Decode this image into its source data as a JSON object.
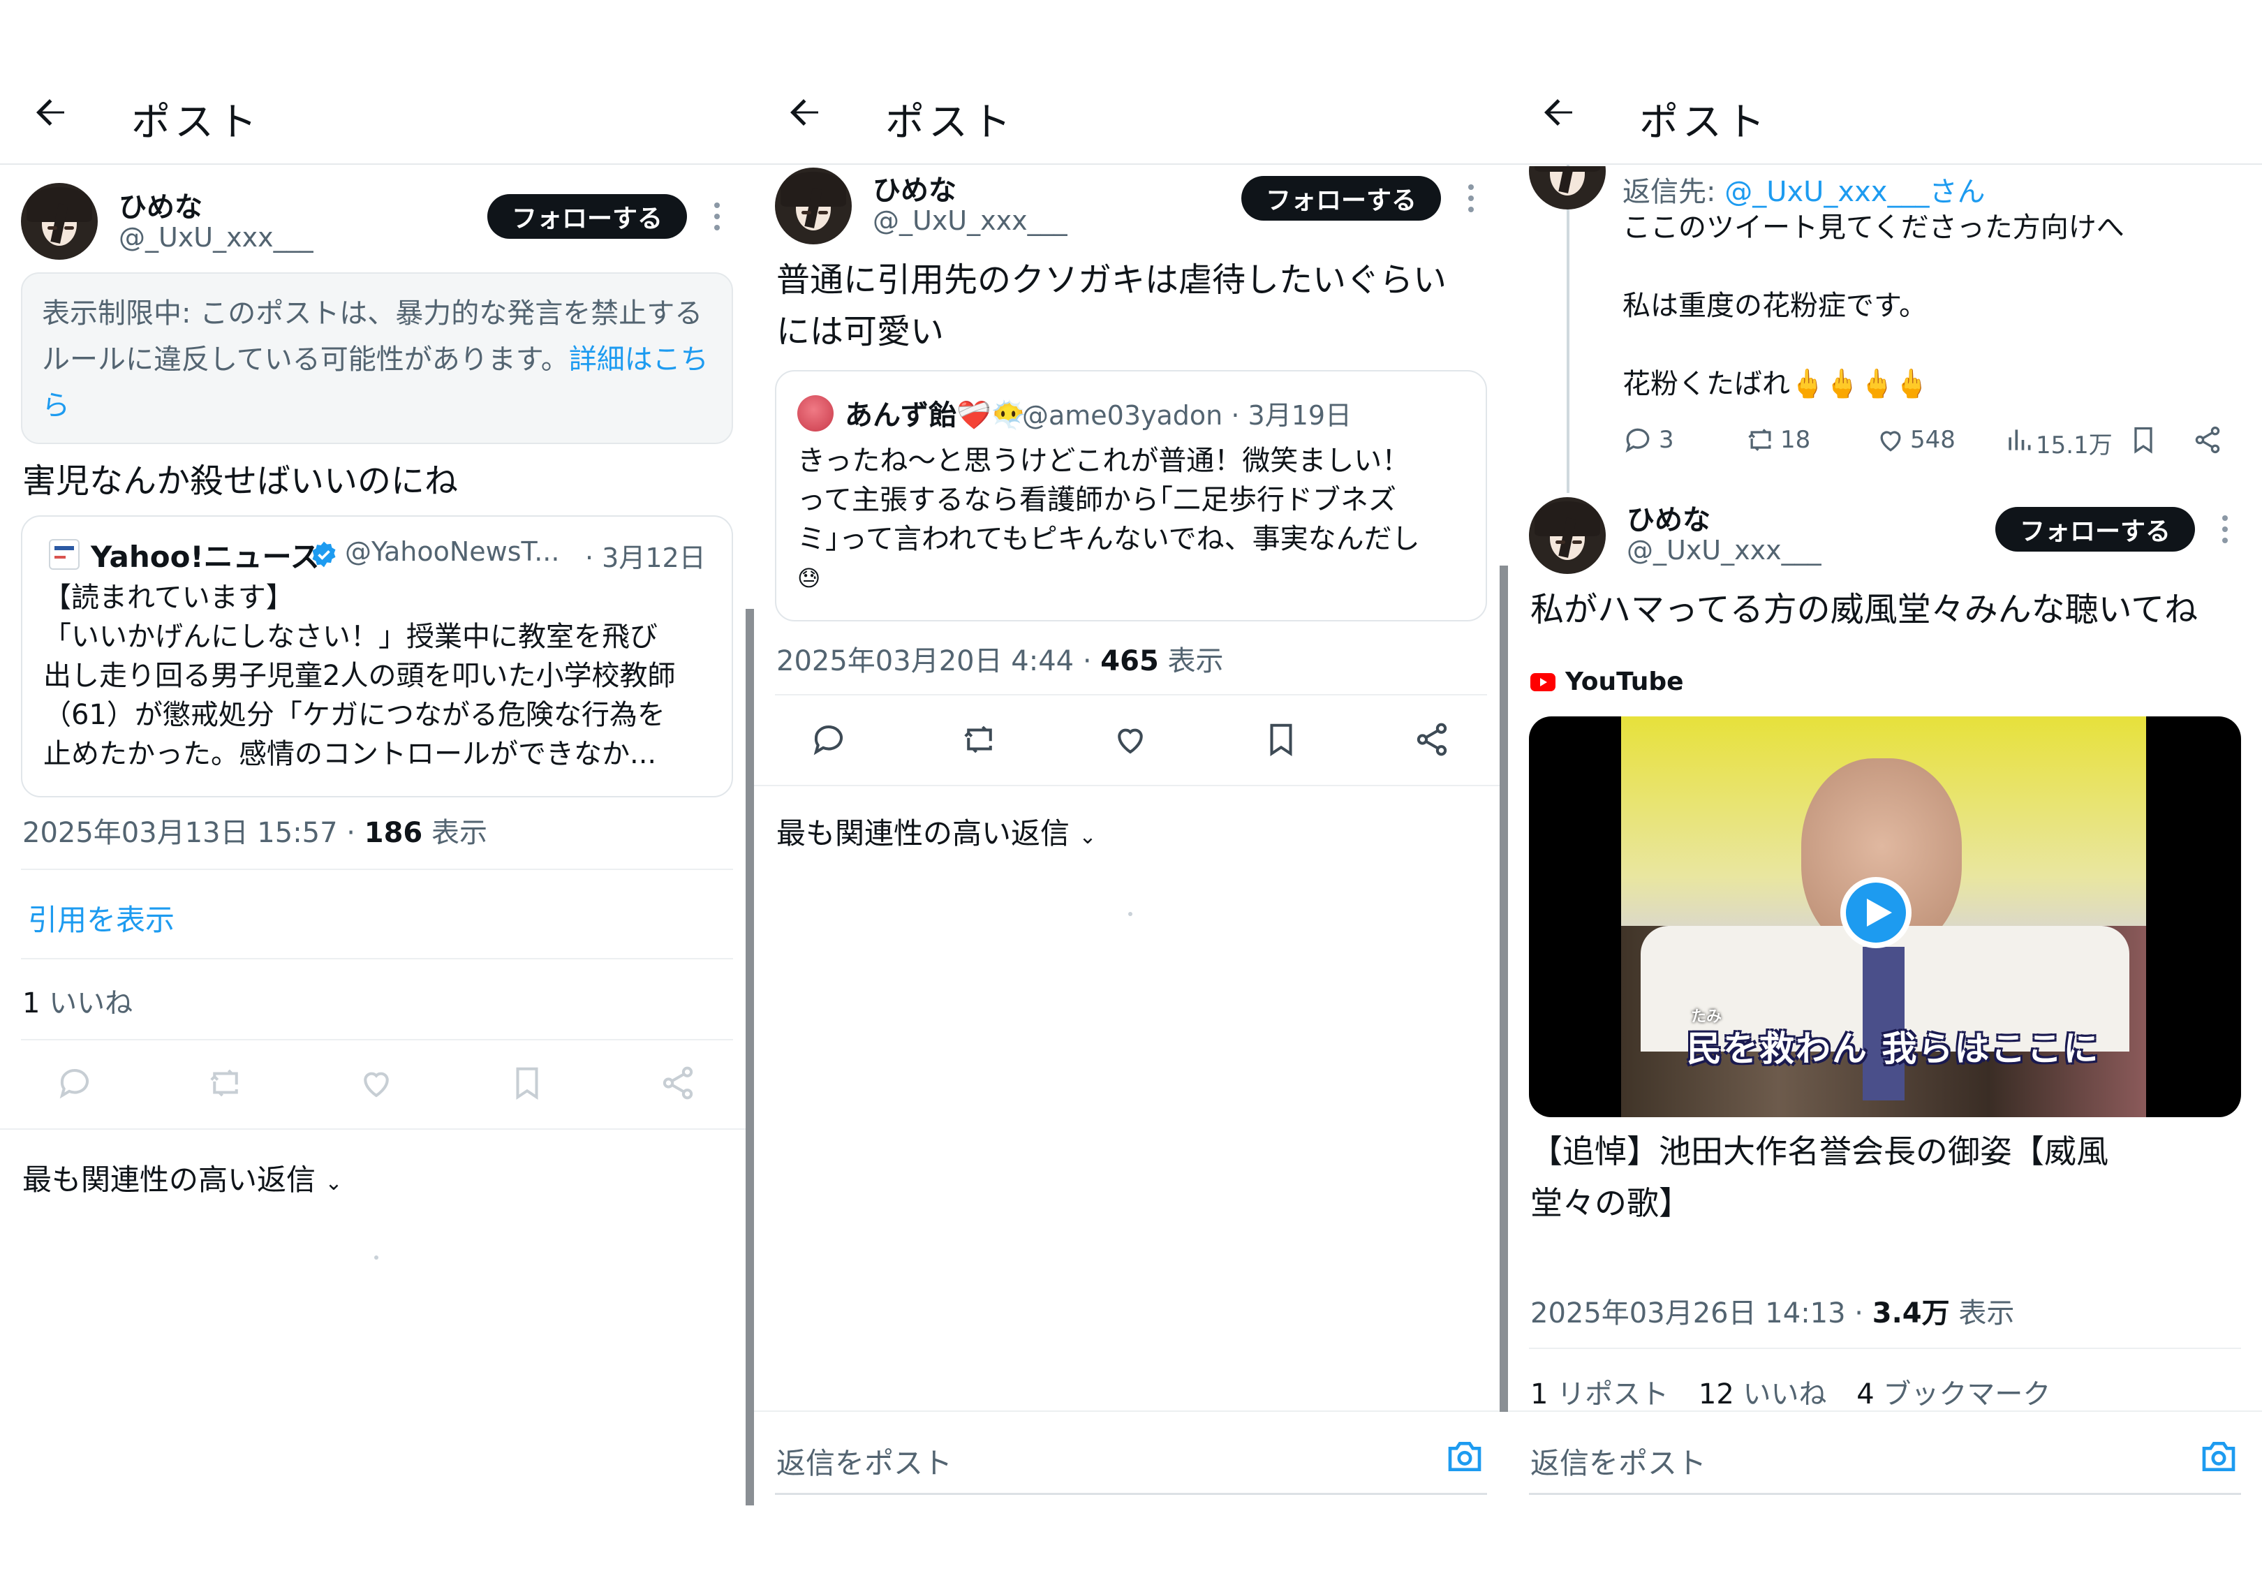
{
  "common": {
    "header_title": "ポスト",
    "follow_label": "フォローする",
    "reply_placeholder": "返信をポスト",
    "sort_replies_label": "最も関連性の高い返信"
  },
  "panel1": {
    "user": {
      "name": "ひめな",
      "handle": "@_UxU_xxx___"
    },
    "notice": {
      "text": "表示制限中: このポストは、暴力的な発言を禁止するルールに違反している可能性があります。",
      "link": "詳細はこちら"
    },
    "text": "害児なんか殺せばいいのにね",
    "quote": {
      "source_name": "Yahoo!ニュース",
      "source_handle": "@YahooNewsT...",
      "date": "· 3月12日",
      "lines": [
        "【読まれています】",
        "「いいかげんにしなさい！」授業中に教室を飛び",
        "出し走り回る男子児童2人の頭を叩いた小学校教師",
        "（61）が懲戒処分「ケガにつながる危険な行為を",
        "止めたかった。感情のコントロールができなか..."
      ]
    },
    "timestamp": "2025年03月13日 15:57",
    "views_count": "186",
    "views_label": "表示",
    "show_quotes": "引用を表示",
    "likes_count": "1",
    "likes_label": "いいね"
  },
  "panel2": {
    "user": {
      "name": "ひめな",
      "handle": "@_UxU_xxx___"
    },
    "text_lines": [
      "普通に引用先のクソガキは虐待したいぐらい",
      "には可愛い"
    ],
    "quote": {
      "name": "あんず飴❤️‍🩹😶‍🌫️",
      "handle": "@ame03yadon",
      "date": "· 3月19日",
      "lines": [
        "きったね〜と思うけどこれが普通！微笑ましい！",
        "って主張するなら看護師から｢二足歩行ドブネズ",
        "ミ｣って言われてもピキんないでね、事実なんだし",
        "😓"
      ]
    },
    "timestamp": "2025年03月20日 4:44",
    "views_count": "465",
    "views_label": "表示"
  },
  "panel3": {
    "reply_to_prefix": "返信先:",
    "reply_to_handle": "@_UxU_xxx___さん",
    "prev_lines": [
      "ここのツイート見てくださった方向けへ",
      "",
      "私は重度の花粉症です。",
      "",
      "花粉くたばれ🖕🖕🖕🖕"
    ],
    "prev_stats": {
      "replies": "3",
      "reposts": "18",
      "likes": "548",
      "views": "15.1万"
    },
    "user": {
      "name": "ひめな",
      "handle": "@_UxU_xxx___"
    },
    "text": "私がハマってる方の威風堂々みんな聴いてね",
    "youtube_label": "YouTube",
    "video_caption_ruby": "たみ",
    "video_caption": "民を救わん 我らはここに",
    "video_title_lines": [
      "【追悼】池田大作名誉会長の御姿【威風",
      "堂々の歌】"
    ],
    "timestamp": "2025年03月26日 14:13",
    "views_count": "3.4万",
    "views_label": "表示",
    "stats": [
      {
        "count": "1",
        "label": "リポスト"
      },
      {
        "count": "12",
        "label": "いいね"
      },
      {
        "count": "4",
        "label": "ブックマーク"
      }
    ]
  },
  "colors": {
    "accent": "#1d9bf0",
    "text": "#0f1419",
    "secondary": "#536471",
    "youtube_red": "#ff0000"
  }
}
